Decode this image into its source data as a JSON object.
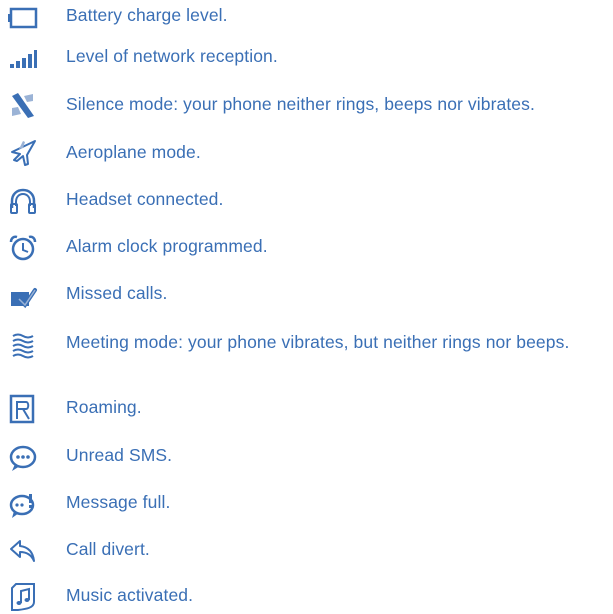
{
  "colors": {
    "text": "#3a6fb5",
    "icon": "#3a6fb5",
    "icon_light": "#9bb3d6"
  },
  "items": [
    {
      "icon": "battery-icon",
      "text": "Battery charge level."
    },
    {
      "icon": "signal-bars-icon",
      "text": "Level of network reception."
    },
    {
      "icon": "silence-mode-icon",
      "text": "Silence mode: your phone neither rings, beeps nor vibrates."
    },
    {
      "icon": "aeroplane-icon",
      "text": "Aeroplane mode."
    },
    {
      "icon": "headset-icon",
      "text": "Headset connected."
    },
    {
      "icon": "alarm-clock-icon",
      "text": "Alarm clock programmed."
    },
    {
      "icon": "missed-call-icon",
      "text": "Missed calls."
    },
    {
      "icon": "meeting-mode-icon",
      "text": "Meeting mode: your phone vibrates, but neither rings nor beeps."
    },
    {
      "icon": "roaming-icon",
      "text": "Roaming."
    },
    {
      "icon": "unread-sms-icon",
      "text": "Unread SMS."
    },
    {
      "icon": "message-full-icon",
      "text": "Message full."
    },
    {
      "icon": "call-divert-icon",
      "text": "Call divert."
    },
    {
      "icon": "music-icon",
      "text": "Music activated."
    }
  ]
}
